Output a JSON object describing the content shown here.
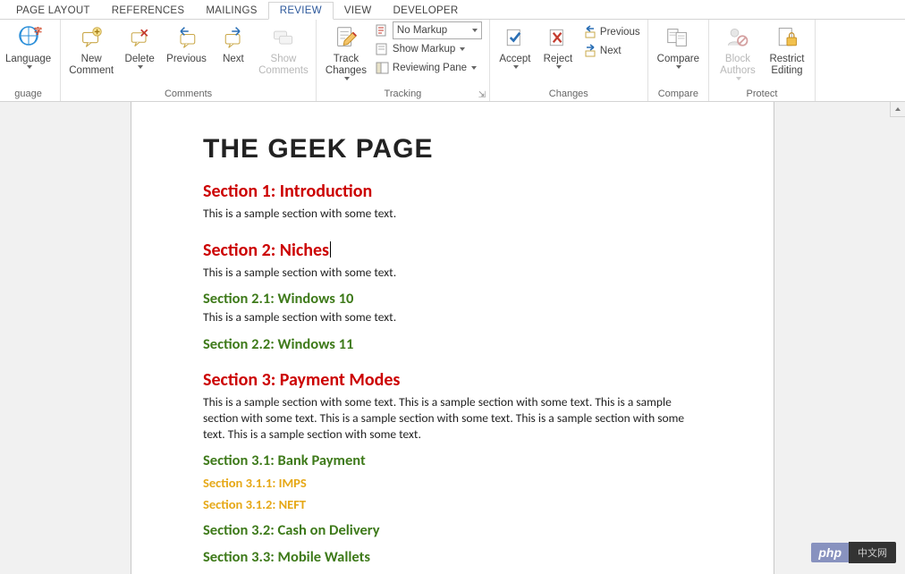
{
  "tabs": [
    "PAGE LAYOUT",
    "REFERENCES",
    "MAILINGS",
    "REVIEW",
    "VIEW",
    "DEVELOPER"
  ],
  "active_tab_index": 3,
  "ribbon": {
    "language": {
      "label": "Language",
      "group": "guage"
    },
    "comments": {
      "new": "New Comment",
      "delete": "Delete",
      "previous": "Previous",
      "next": "Next",
      "show": "Show Comments",
      "group": "Comments"
    },
    "tracking": {
      "track": "Track Changes",
      "combo": "No Markup",
      "show_markup": "Show Markup",
      "reviewing": "Reviewing Pane",
      "group": "Tracking"
    },
    "changes": {
      "accept": "Accept",
      "reject": "Reject",
      "prev": "Previous",
      "next": "Next",
      "group": "Changes"
    },
    "compare": {
      "label": "Compare",
      "group": "Compare"
    },
    "protect": {
      "block": "Block Authors",
      "restrict": "Restrict Editing",
      "group": "Protect"
    }
  },
  "doc": {
    "title": "THE GEEK PAGE",
    "s1": {
      "h": "Section 1: Introduction",
      "t": "This is a sample section with some text."
    },
    "s2": {
      "h": "Section 2: Niches",
      "t": "This is a sample section with some text."
    },
    "s21": {
      "h": "Section 2.1: Windows 10",
      "t": "This is a sample section with some text."
    },
    "s22": {
      "h": "Section 2.2: Windows 11"
    },
    "s3": {
      "h": "Section 3: Payment Modes",
      "t": "This is a sample section with some text. This is a sample section with some text. This is a sample section with some text. This is a sample section with some text. This is a sample section with some text. This is a sample section with some text."
    },
    "s31": {
      "h": "Section 3.1: Bank Payment"
    },
    "s311": {
      "h": "Section 3.1.1: IMPS"
    },
    "s312": {
      "h": "Section 3.1.2: NEFT"
    },
    "s32": {
      "h": "Section 3.2: Cash on Delivery"
    },
    "s33": {
      "h": "Section 3.3: Mobile Wallets"
    }
  },
  "badge": {
    "a": "php",
    "b": "中文网"
  }
}
